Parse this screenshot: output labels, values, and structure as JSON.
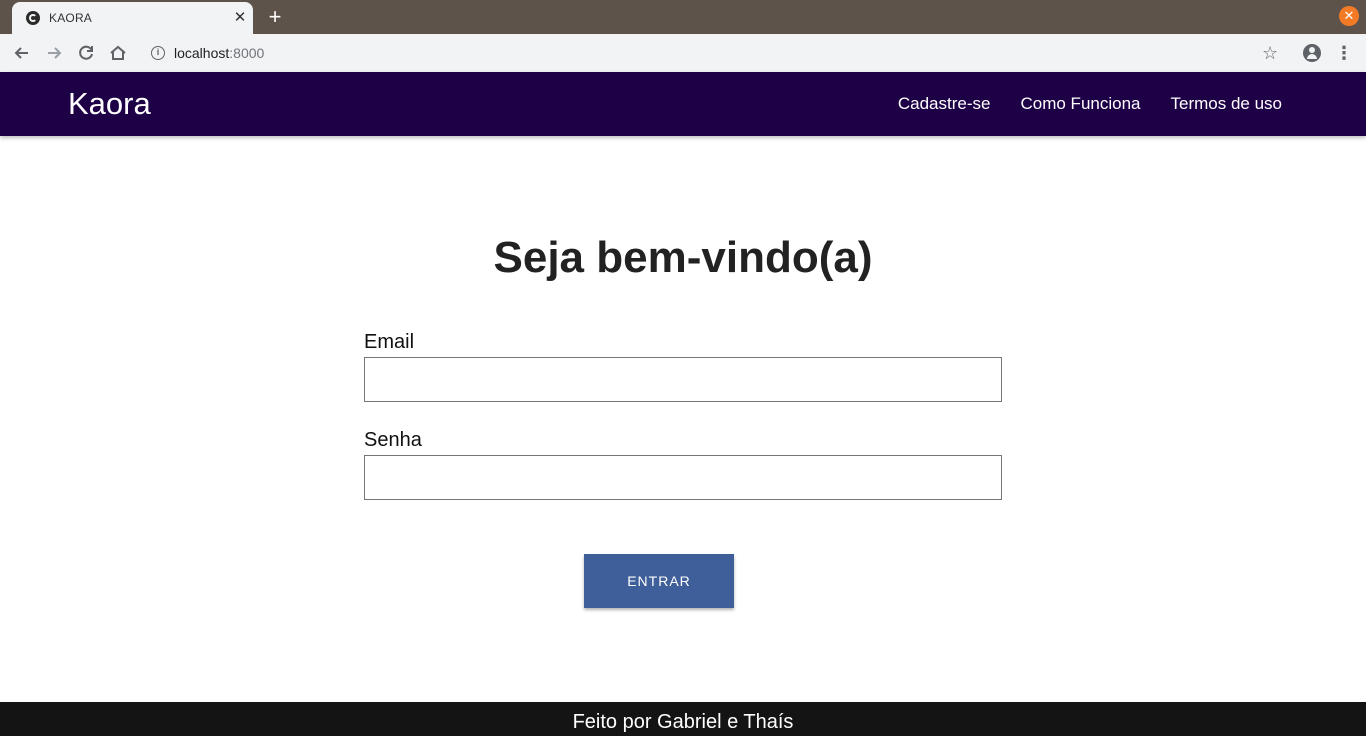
{
  "browser": {
    "tab_title": "KAORA",
    "tab_close": "✕",
    "new_tab": "+",
    "window_close": "✕",
    "url_host": "localhost",
    "url_port": ":8000",
    "icons": [
      "back-icon",
      "forward-icon",
      "reload-icon",
      "home-icon",
      "info-icon",
      "star-icon",
      "profile-icon",
      "menu-dots-icon"
    ]
  },
  "navbar": {
    "brand": "Kaora",
    "links": [
      "Cadastre-se",
      "Como Funciona",
      "Termos de uso"
    ],
    "background": "#1e0047"
  },
  "main": {
    "heading": "Seja bem-vindo(a)",
    "email_label": "Email",
    "email_value": "",
    "password_label": "Senha",
    "password_value": "",
    "submit_label": "ENTRAR",
    "button_color": "#3f5f9a"
  },
  "footer": {
    "text": "Feito por Gabriel e Thaís"
  }
}
